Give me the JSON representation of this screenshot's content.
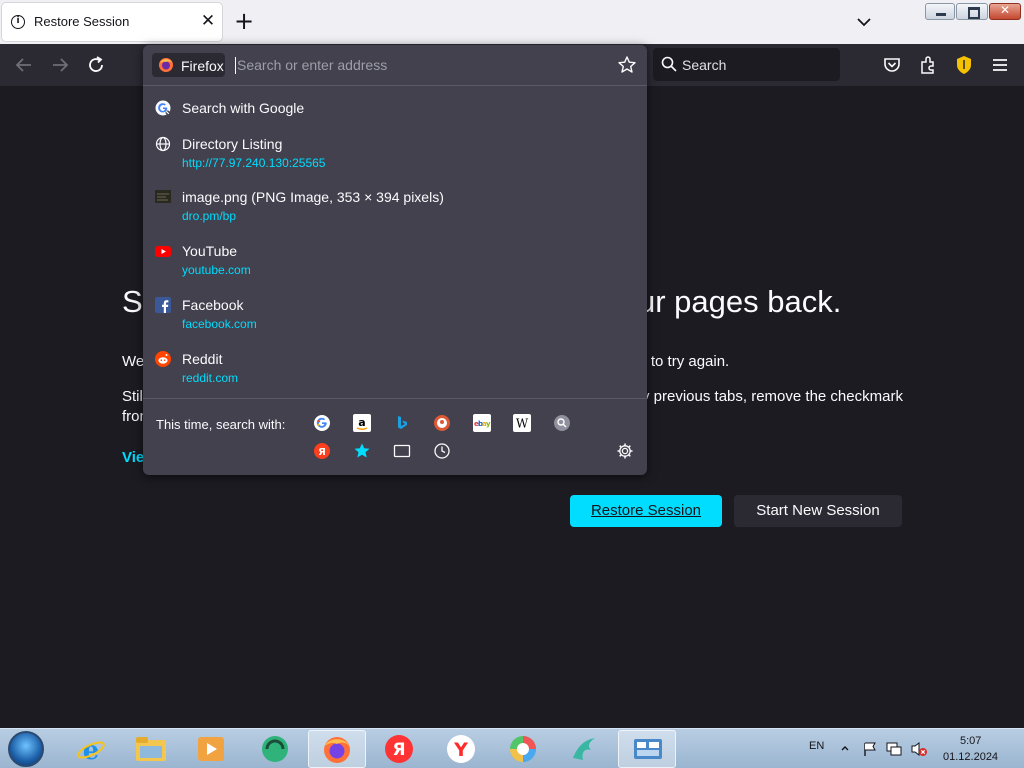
{
  "tab": {
    "title": "Restore Session",
    "close": "✕"
  },
  "newtab": "+",
  "urlbar": {
    "identity_label": "Firefox",
    "placeholder": "Search or enter address"
  },
  "searchbar": {
    "placeholder": "Search"
  },
  "dropdown": {
    "results": [
      {
        "title": "Search with Google",
        "url": "",
        "icon": "google-icon"
      },
      {
        "title": "Directory Listing",
        "url": "http://77.97.240.130:25565",
        "icon": "globe-icon"
      },
      {
        "title": "image.png (PNG Image, 353 × 394 pixels)",
        "url": "dro.pm/bp",
        "icon": "image-thumbnail-icon"
      },
      {
        "title": "YouTube",
        "url": "youtube.com",
        "icon": "youtube-icon"
      },
      {
        "title": "Facebook",
        "url": "facebook.com",
        "icon": "facebook-icon"
      },
      {
        "title": "Reddit",
        "url": "reddit.com",
        "icon": "reddit-icon"
      }
    ],
    "oneoff_label": "This time, search with:",
    "engines": [
      "google",
      "amazon",
      "bing",
      "duckduckgo",
      "ebay",
      "wikipedia",
      "search",
      "yandex",
      "bookmarks",
      "tabs",
      "history"
    ]
  },
  "page": {
    "headline_start": "So",
    "headline_end": "ur pages back.",
    "line1_start": "We",
    "line1_end": "on to try again.",
    "line2_start": "Stil",
    "line2_end": "y previous tabs, remove the checkmark",
    "line3_start": "fron",
    "link": "Vie",
    "restore_button": "Restore Session",
    "new_session_button": "Start New Session"
  },
  "taskbar": {
    "language": "EN",
    "time": "5:07",
    "date": "01.12.2024"
  },
  "colors": {
    "accent": "#00ddff",
    "page_bg": "#1c1b22",
    "toolbar_bg": "#2b2a33",
    "panel_bg": "#42414d"
  }
}
